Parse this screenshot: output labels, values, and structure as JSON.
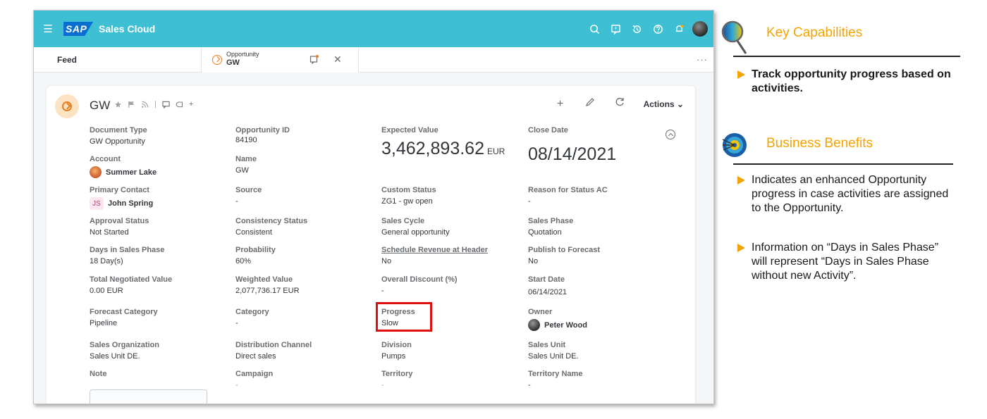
{
  "shellbar": {
    "brand": "SAP",
    "app_title": "Sales Cloud",
    "icons": [
      "search-icon",
      "feedback-icon",
      "history-icon",
      "help-icon",
      "notifications-icon",
      "user-avatar"
    ],
    "color": "#3fbfd3"
  },
  "tabs": {
    "feed": "Feed",
    "opportunity_type": "Opportunity",
    "opportunity_name": "GW",
    "close_symbol": "✕",
    "more": "···"
  },
  "object": {
    "title": "GW",
    "actions_label": "Actions",
    "actions_chevron": "⌄",
    "plus": "+"
  },
  "fields": {
    "document_type": {
      "label": "Document Type",
      "value": "GW Opportunity"
    },
    "account": {
      "label": "Account",
      "value": "Summer Lake"
    },
    "primary_contact": {
      "label": "Primary Contact",
      "initials": "JS",
      "value": "John Spring"
    },
    "approval_status": {
      "label": "Approval Status",
      "value": "Not Started"
    },
    "days_in_sales_phase": {
      "label": "Days in Sales Phase",
      "value": "18 Day(s)"
    },
    "total_negotiated_value": {
      "label": "Total Negotiated Value",
      "value": "0.00 EUR"
    },
    "forecast_category": {
      "label": "Forecast Category",
      "value": "Pipeline"
    },
    "sales_organization": {
      "label": "Sales Organization",
      "value": "Sales Unit DE."
    },
    "note": {
      "label": "Note"
    },
    "opportunity_id": {
      "label": "Opportunity ID",
      "value": "84190"
    },
    "name": {
      "label": "Name",
      "value": "GW"
    },
    "source": {
      "label": "Source",
      "value": "-"
    },
    "consistency_status": {
      "label": "Consistency Status",
      "value": "Consistent"
    },
    "probability": {
      "label": "Probability",
      "value": "60%"
    },
    "weighted_value": {
      "label": "Weighted Value",
      "value": "2,077,736.17 EUR"
    },
    "category": {
      "label": "Category",
      "value": "-"
    },
    "distribution_channel": {
      "label": "Distribution Channel",
      "value": "Direct sales"
    },
    "campaign": {
      "label": "Campaign",
      "value": "-"
    },
    "expected_value": {
      "label": "Expected Value",
      "value": "3,462,893.62",
      "currency": "EUR"
    },
    "custom_status": {
      "label": "Custom Status",
      "value": "ZG1 - gw open"
    },
    "sales_cycle": {
      "label": "Sales Cycle",
      "value": "General opportunity"
    },
    "schedule_revenue": {
      "label": "Schedule Revenue at Header",
      "value": "No"
    },
    "overall_discount": {
      "label": "Overall Discount (%)",
      "value": "-"
    },
    "progress": {
      "label": "Progress",
      "value": "Slow"
    },
    "division": {
      "label": "Division",
      "value": "Pumps"
    },
    "territory": {
      "label": "Territory",
      "value": "-"
    },
    "close_date": {
      "label": "Close Date",
      "value": "08/14/2021"
    },
    "reason_for_status": {
      "label": "Reason for Status AC",
      "value": "-"
    },
    "sales_phase": {
      "label": "Sales Phase",
      "value": "Quotation"
    },
    "publish_to_forecast": {
      "label": "Publish to Forecast",
      "value": "No"
    },
    "start_date": {
      "label": "Start Date",
      "value": "06/14/2021"
    },
    "owner": {
      "label": "Owner",
      "value": "Peter Wood"
    },
    "sales_unit": {
      "label": "Sales Unit",
      "value": "Sales Unit DE."
    },
    "territory_name": {
      "label": "Territory Name",
      "value": "-"
    }
  },
  "panel": {
    "accent": "#f5a300",
    "key_capabilities": {
      "title": "Key Capabilities",
      "bullets": [
        "Track opportunity progress based on activities."
      ]
    },
    "business_benefits": {
      "title": "Business Benefits",
      "bullets": [
        "Indicates an enhanced Opportunity progress in case activities are assigned to the Opportunity.",
        "Information on “Days in Sales Phase” will represent “Days in Sales Phase without new Activity”."
      ]
    }
  }
}
